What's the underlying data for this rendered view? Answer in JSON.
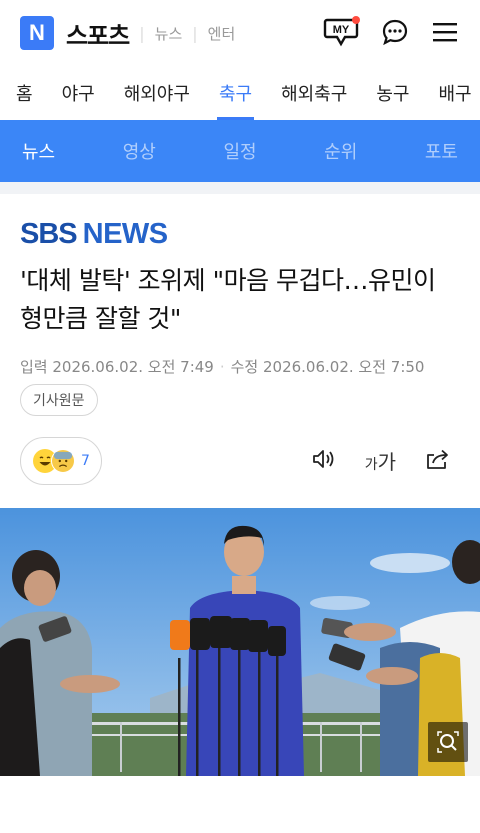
{
  "header": {
    "logo_letter": "N",
    "brand": "스포츠",
    "sub_links": [
      "뉴스",
      "엔터"
    ],
    "my_label": "MY",
    "icons": [
      "my-icon",
      "chat-icon",
      "menu-icon"
    ]
  },
  "categories": [
    "홈",
    "야구",
    "해외야구",
    "축구",
    "해외축구",
    "농구",
    "배구"
  ],
  "active_category": "축구",
  "subtabs": [
    "뉴스",
    "영상",
    "일정",
    "순위",
    "포토"
  ],
  "active_subtab": "뉴스",
  "article": {
    "press_1": "SBS",
    "press_2": "NEWS",
    "title": "'대체 발탁' 조위제 \"마음 무겁다…유민이 형만큼 잘할 것\"",
    "input_date": "입력 2026.06.02. 오전 7:49",
    "edit_date": "수정 2026.06.02. 오전 7:50",
    "original_label": "기사원문",
    "reaction_count": "7",
    "font_small": "가",
    "font_big": "가"
  },
  "colors": {
    "accent": "#3b7bf7",
    "subnav_bg": "#3b86f7",
    "press": "#1a4fa8"
  }
}
